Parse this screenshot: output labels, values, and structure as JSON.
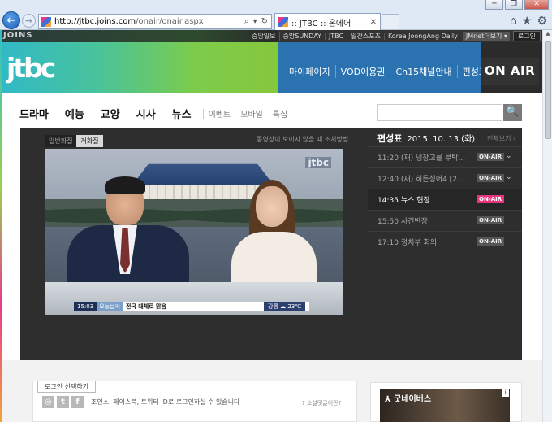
{
  "browser": {
    "url_domain": "http://jtbc.joins.com",
    "url_path": "/onair/onair.aspx",
    "tab_title": ":: JTBC :: 온에어",
    "tab_close": "✕",
    "window_minimize": "─",
    "window_restore": "❐",
    "window_close": "✕",
    "back_glyph": "←",
    "forward_glyph": "→",
    "addr_search": "⌕",
    "addr_dropdown": "▾",
    "addr_refresh": "↻",
    "tool_home": "⌂",
    "tool_favorites": "★",
    "tool_settings": "⚙"
  },
  "utility": {
    "logo": "JOINS",
    "links": [
      "중앙일보",
      "중앙SUNDAY",
      "JTBC",
      "일간스포츠",
      "Korea JoongAng Daily",
      "JMnet더보기 ▾"
    ],
    "login": "로그인"
  },
  "header": {
    "logo": "jtbc",
    "nav": [
      "마이페이지",
      "VOD이용권",
      "Ch15채널안내",
      "편성표"
    ],
    "on_air": "ON AIR"
  },
  "main_nav": {
    "primary": [
      "드라마",
      "예능",
      "교양",
      "시사",
      "뉴스"
    ],
    "secondary": [
      "이벤트",
      "모바일",
      "특집"
    ],
    "search_icon": "🔍"
  },
  "player": {
    "tabs": [
      "일반화질",
      "저화질"
    ],
    "help": "동영상이 보이지 않을 때 조치방법",
    "bug": "jtbc",
    "ticker_time": "15:03",
    "ticker_tag": "오늘날씨",
    "ticker_headline": "전국 대체로 맑음",
    "weather": "강릉 ☁ 23℃"
  },
  "schedule": {
    "title": "편성표",
    "date": "2015. 10. 13 (화)",
    "all_link": "전체보기 ›",
    "items": [
      {
        "time": "11:20",
        "title": "(재) 냉장고를 부탁...",
        "badge": "ON-AIR",
        "chev": "⌄"
      },
      {
        "time": "12:40",
        "title": "(재) 히든싱어4 [2...",
        "badge": "ON-AIR",
        "chev": "⌄"
      },
      {
        "time": "14:35",
        "title": "뉴스 현장",
        "badge": "ON-AIR",
        "chev": ""
      },
      {
        "time": "15:50",
        "title": "사건반장",
        "badge": "ON-AIR",
        "chev": ""
      },
      {
        "time": "17:10",
        "title": "정치부 회의",
        "badge": "ON-AIR",
        "chev": ""
      }
    ]
  },
  "comments": {
    "login_tip": "로그인 선택하기",
    "icons": [
      "◎",
      "t",
      "f"
    ],
    "social_text": "조인스, 페이스북, 트위터 ID로 로그인하실 수 있습니다",
    "social_help": "? 소셜댓글이란?"
  },
  "ad": {
    "text": "⅄ 굿네이버스",
    "info": "i"
  }
}
